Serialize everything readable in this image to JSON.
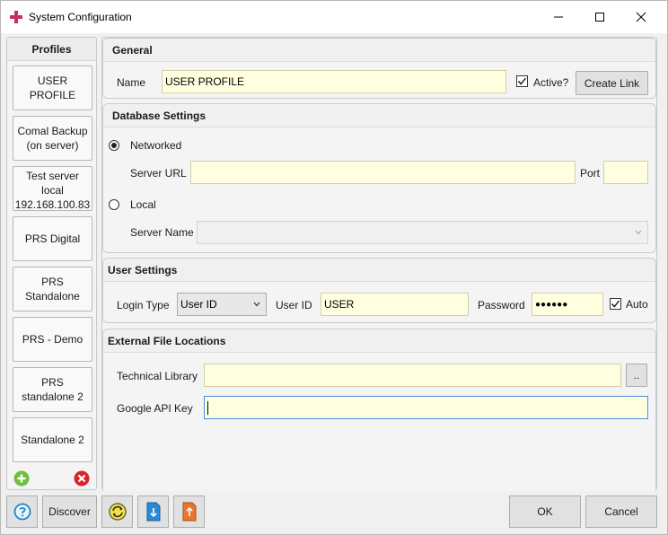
{
  "window": {
    "title": "System Configuration",
    "minimize_glyph": "—",
    "maximize_glyph": "☐",
    "close_glyph": "✕",
    "icon": "app-logo-icon",
    "accent": "#c0306a"
  },
  "profiles": {
    "header": "Profiles",
    "items": [
      {
        "label": "USER PROFILE"
      },
      {
        "label": "Comal Backup\n(on server)"
      },
      {
        "label": "Test server\nlocal\n192.168.100.83"
      },
      {
        "label": "PRS Digital"
      },
      {
        "label": "PRS\nStandalone"
      },
      {
        "label": "PRS - Demo"
      },
      {
        "label": "PRS\nstandalone 2"
      },
      {
        "label": "Standalone 2"
      }
    ],
    "add_icon": "plus-circle-icon",
    "remove_icon": "x-circle-icon"
  },
  "general": {
    "title": "General",
    "name_label": "Name",
    "name_value": "USER PROFILE",
    "active_label": "Active?",
    "active_checked": true,
    "create_link_label": "Create Link"
  },
  "database": {
    "title": "Database Settings",
    "networked_label": "Networked",
    "networked_selected": true,
    "server_url_label": "Server URL",
    "server_url_value": "",
    "port_label": "Port",
    "port_value": "",
    "local_label": "Local",
    "local_selected": false,
    "server_name_label": "Server Name",
    "server_name_value": ""
  },
  "user": {
    "title": "User Settings",
    "login_type_label": "Login Type",
    "login_type_value": "User ID",
    "user_id_label": "User ID",
    "user_id_value": "USER",
    "password_label": "Password",
    "password_value": "●●●●●●",
    "auto_label": "Auto",
    "auto_checked": true
  },
  "files": {
    "title": "External File Locations",
    "tech_library_label": "Technical Library",
    "tech_library_value": "",
    "browse_label": "..",
    "google_api_label": "Google API Key",
    "google_api_value": ""
  },
  "footer": {
    "help_icon": "help-question-icon",
    "discover_label": "Discover",
    "refresh_icon": "refresh-icon",
    "import_icon": "import-download-icon",
    "export_icon": "export-upload-icon",
    "ok_label": "OK",
    "cancel_label": "Cancel"
  },
  "colors": {
    "field_bg": "#ffffe0",
    "add_green": "#6fbf40",
    "remove_red": "#d9252a",
    "help_blue": "#1e88c8",
    "export_orange": "#e8762d"
  }
}
